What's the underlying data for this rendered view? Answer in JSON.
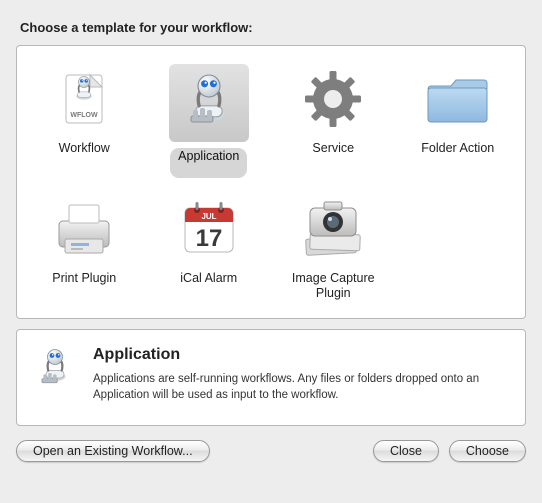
{
  "heading": "Choose a template for your workflow:",
  "templates": [
    {
      "id": "workflow",
      "label": "Workflow",
      "icon": "workflow-icon",
      "selected": false
    },
    {
      "id": "application",
      "label": "Application",
      "icon": "application-icon",
      "selected": true
    },
    {
      "id": "service",
      "label": "Service",
      "icon": "service-icon",
      "selected": false
    },
    {
      "id": "folder-action",
      "label": "Folder Action",
      "icon": "folder-icon",
      "selected": false
    },
    {
      "id": "print-plugin",
      "label": "Print Plugin",
      "icon": "printer-icon",
      "selected": false
    },
    {
      "id": "ical-alarm",
      "label": "iCal Alarm",
      "icon": "calendar-icon",
      "selected": false
    },
    {
      "id": "image-capture-plugin",
      "label": "Image Capture Plugin",
      "icon": "camera-icon",
      "selected": false
    }
  ],
  "calendar": {
    "month": "JUL",
    "day": "17"
  },
  "workflow_doc_label": "WFLOW",
  "details": {
    "title": "Application",
    "description": "Applications are self-running workflows. Any files or folders dropped onto an Application will be used as input to the workflow."
  },
  "buttons": {
    "open_existing": "Open an Existing Workflow...",
    "close": "Close",
    "choose": "Choose"
  }
}
